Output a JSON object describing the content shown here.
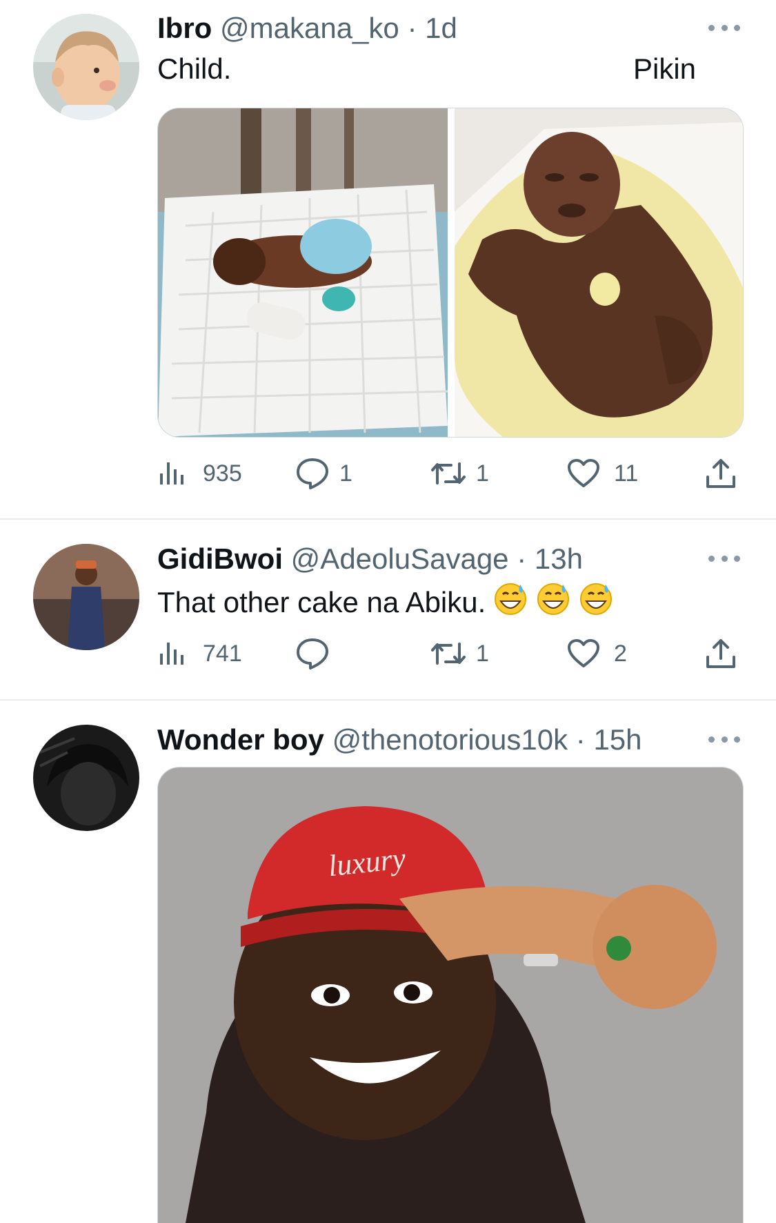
{
  "tweets": [
    {
      "name": "Ibro",
      "handle": "@makana_ko",
      "sep": "·",
      "time": "1d",
      "text_left": "Child.",
      "text_right": "Pikin",
      "stats": {
        "views": "935",
        "replies": "1",
        "retweets": "1",
        "likes": "11"
      }
    },
    {
      "name": "GidiBwoi",
      "handle": "@AdeoluSavage",
      "sep": "·",
      "time": "13h",
      "text": "That other cake na Abiku.",
      "stats": {
        "views": "741",
        "replies": "",
        "retweets": "1",
        "likes": "2"
      }
    },
    {
      "name": "Wonder boy",
      "handle": "@thenotorious10k",
      "sep": "·",
      "time": "15h",
      "cap_text": "luxury"
    }
  ],
  "icons": {
    "views": "bar-chart-icon",
    "reply": "speech-bubble-icon",
    "retweet": "retweet-arrows-icon",
    "like": "heart-icon",
    "share": "share-upload-icon",
    "more": "more-dots-icon",
    "emoji": "grinning-sweat-emoji"
  },
  "colors": {
    "secondary_text": "#536471",
    "divider": "#e6ecf0",
    "dots": "#8b98a5"
  }
}
